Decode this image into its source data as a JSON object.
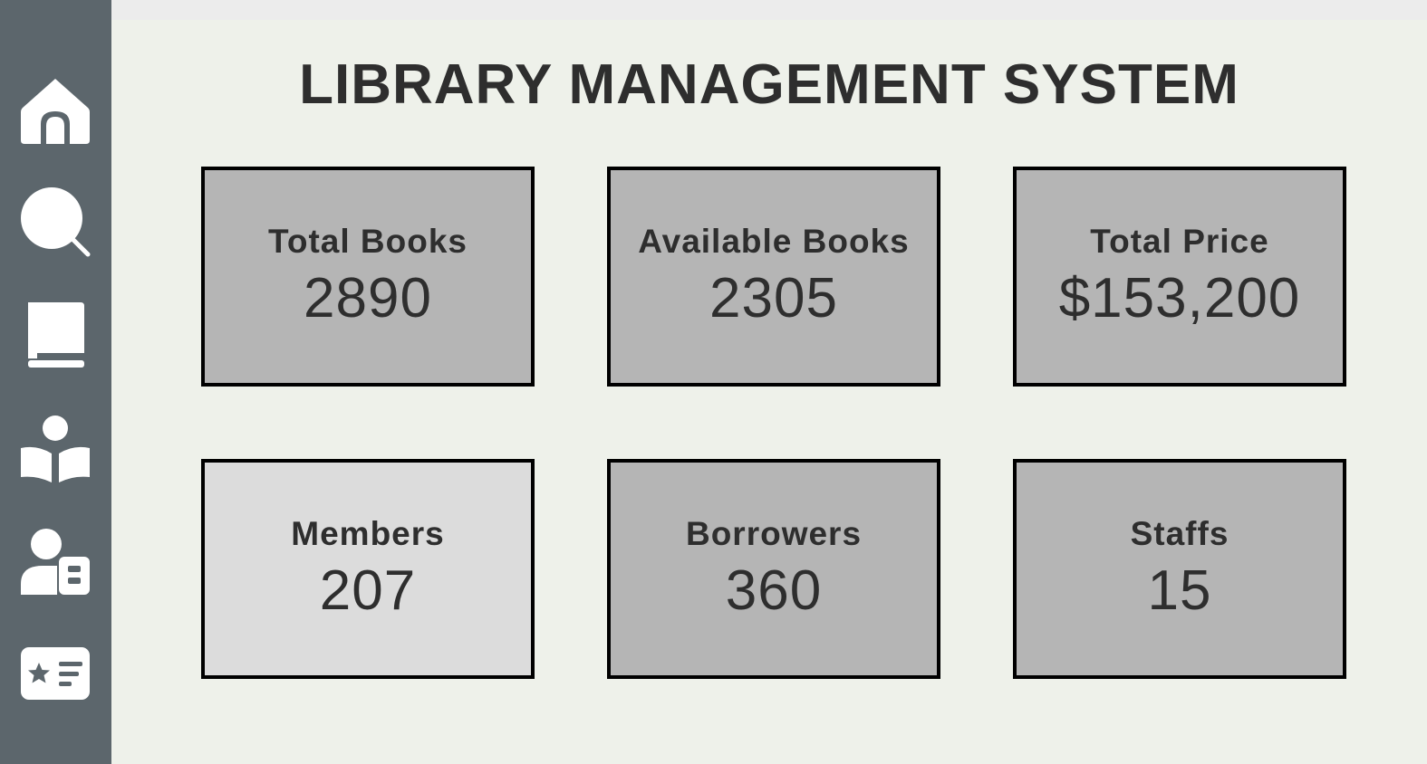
{
  "app": {
    "title": "LIBRARY MANAGEMENT SYSTEM"
  },
  "sidebar": {
    "items": [
      {
        "icon": "home-icon"
      },
      {
        "icon": "search-icon"
      },
      {
        "icon": "book-icon"
      },
      {
        "icon": "reader-icon"
      },
      {
        "icon": "user-contact-icon"
      },
      {
        "icon": "id-card-icon"
      }
    ]
  },
  "stats": [
    {
      "label": "Total Books",
      "value": "2890"
    },
    {
      "label": "Available Books",
      "value": "2305"
    },
    {
      "label": "Total Price",
      "value": "$153,200"
    },
    {
      "label": "Members",
      "value": "207"
    },
    {
      "label": "Borrowers",
      "value": "360"
    },
    {
      "label": "Staffs",
      "value": "15"
    }
  ],
  "colors": {
    "sidebar": "#5c666c",
    "background": "#eef1ea",
    "card": "#b5b5b5",
    "card_highlight": "#dcdcdc",
    "text": "#2e2e2e"
  }
}
